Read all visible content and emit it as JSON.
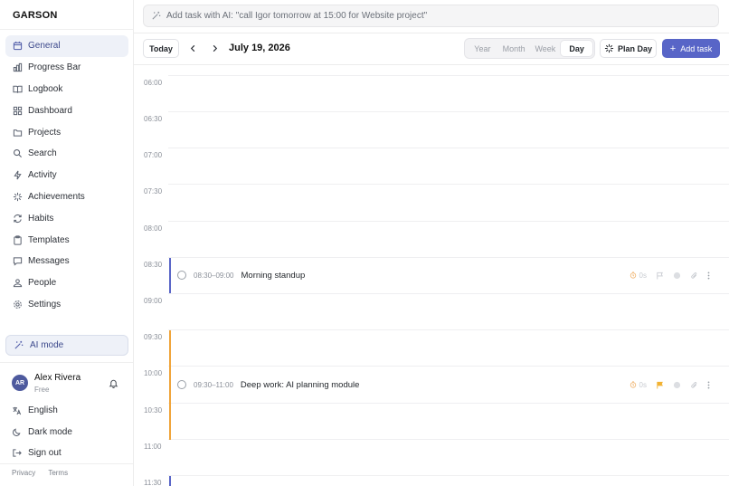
{
  "app": {
    "logo": "GARSON"
  },
  "sidebar": {
    "items": [
      {
        "label": "General",
        "icon": "calendar-icon",
        "active": true
      },
      {
        "label": "Progress Bar",
        "icon": "bar-chart-icon"
      },
      {
        "label": "Logbook",
        "icon": "book-icon"
      },
      {
        "label": "Dashboard",
        "icon": "grid-icon"
      },
      {
        "label": "Projects",
        "icon": "folder-icon"
      },
      {
        "label": "Search",
        "icon": "search-icon"
      },
      {
        "label": "Activity",
        "icon": "activity-icon"
      },
      {
        "label": "Achievements",
        "icon": "sparkle-icon"
      },
      {
        "label": "Habits",
        "icon": "repeat-icon"
      },
      {
        "label": "Templates",
        "icon": "clipboard-icon"
      },
      {
        "label": "Messages",
        "icon": "message-icon"
      },
      {
        "label": "People",
        "icon": "people-icon"
      },
      {
        "label": "Settings",
        "icon": "gear-icon"
      }
    ],
    "ai_mode": "AI mode",
    "user": {
      "initials": "AR",
      "name": "Alex Rivera",
      "plan": "Free"
    },
    "bottom": [
      {
        "label": "English",
        "icon": "language-icon"
      },
      {
        "label": "Dark mode",
        "icon": "moon-icon"
      },
      {
        "label": "Sign out",
        "icon": "sign-out-icon"
      }
    ],
    "footer": {
      "privacy": "Privacy",
      "terms": "Terms"
    }
  },
  "header": {
    "ai_placeholder": "Add task with AI: \"call Igor tomorrow at 15:00 for Website project\""
  },
  "toolbar": {
    "today": "Today",
    "date": "July 19, 2026",
    "views": [
      "Year",
      "Month",
      "Week",
      "Day"
    ],
    "active_view": "Day",
    "plan_day": "Plan Day",
    "add_task": "Add task"
  },
  "calendar": {
    "time_labels": [
      "06:00",
      "06:30",
      "07:00",
      "07:30",
      "08:00",
      "08:30",
      "09:00",
      "09:30",
      "10:00",
      "10:30",
      "11:00",
      "11:30"
    ],
    "events": [
      {
        "time": "08:30–09:00",
        "title": "Morning standup",
        "color": "#5a66c8",
        "estimate": "0s",
        "flagged": false
      },
      {
        "time": "09:30–11:00",
        "title": "Deep work: AI planning module",
        "color": "#f0a43a",
        "estimate": "0s",
        "flagged": true
      }
    ]
  },
  "colors": {
    "accent": "#5865c7",
    "active_bg": "#eef1f8"
  }
}
